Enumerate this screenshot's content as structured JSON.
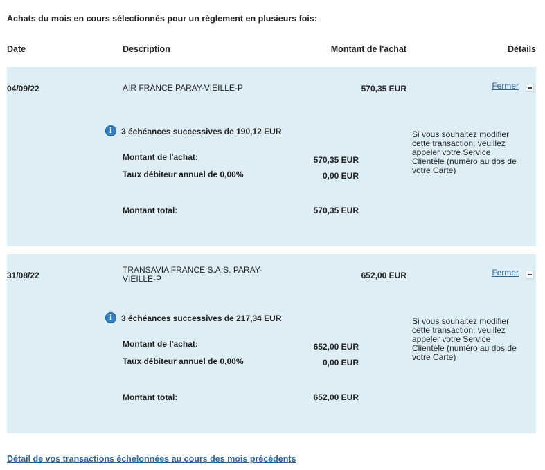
{
  "intro": "Achats du mois en cours sélectionnés pour un règlement en plusieurs fois:",
  "headers": {
    "date": "Date",
    "description": "Description",
    "amount": "Montant de l'achat",
    "details": "Détails"
  },
  "transactions": [
    {
      "date": "04/09/22",
      "description": "AIR FRANCE PARAY-VIEILLE-P",
      "amount": "570,35 EUR",
      "close_label": "Fermer",
      "installments": "3 échéances successives de 190,12 EUR",
      "purchase_label": "Montant de l'achat:",
      "purchase_value": "570,35 EUR",
      "rate_label": "Taux débiteur annuel de 0,00%",
      "rate_value": "0,00 EUR",
      "total_label": "Montant total:",
      "total_value": "570,35 EUR",
      "note": "Si vous souhaitez modifier cette transaction, veuillez appeler votre Service Clientèle (numéro au dos de votre Carte)"
    },
    {
      "date": "31/08/22",
      "description": "TRANSAVIA FRANCE S.A.S. PARAY-VIEILLE-P",
      "amount": "652,00 EUR",
      "close_label": "Fermer",
      "installments": "3 échéances successives de 217,34 EUR",
      "purchase_label": "Montant de l'achat:",
      "purchase_value": "652,00 EUR",
      "rate_label": "Taux débiteur annuel de 0,00%",
      "rate_value": "0,00 EUR",
      "total_label": "Montant total:",
      "total_value": "652,00 EUR",
      "note": "Si vous souhaitez modifier cette transaction, veuillez appeler votre Service Clientèle (numéro au dos de votre Carte)"
    }
  ],
  "footer_link": "Détail de vos transactions échelonnées au cours des mois précédents",
  "colors": {
    "panel_bg": "#deeef7",
    "link": "#2a6496",
    "info_icon": "#2f7fc4"
  },
  "icons": {
    "info": "info-icon",
    "collapse": "minus-icon"
  }
}
